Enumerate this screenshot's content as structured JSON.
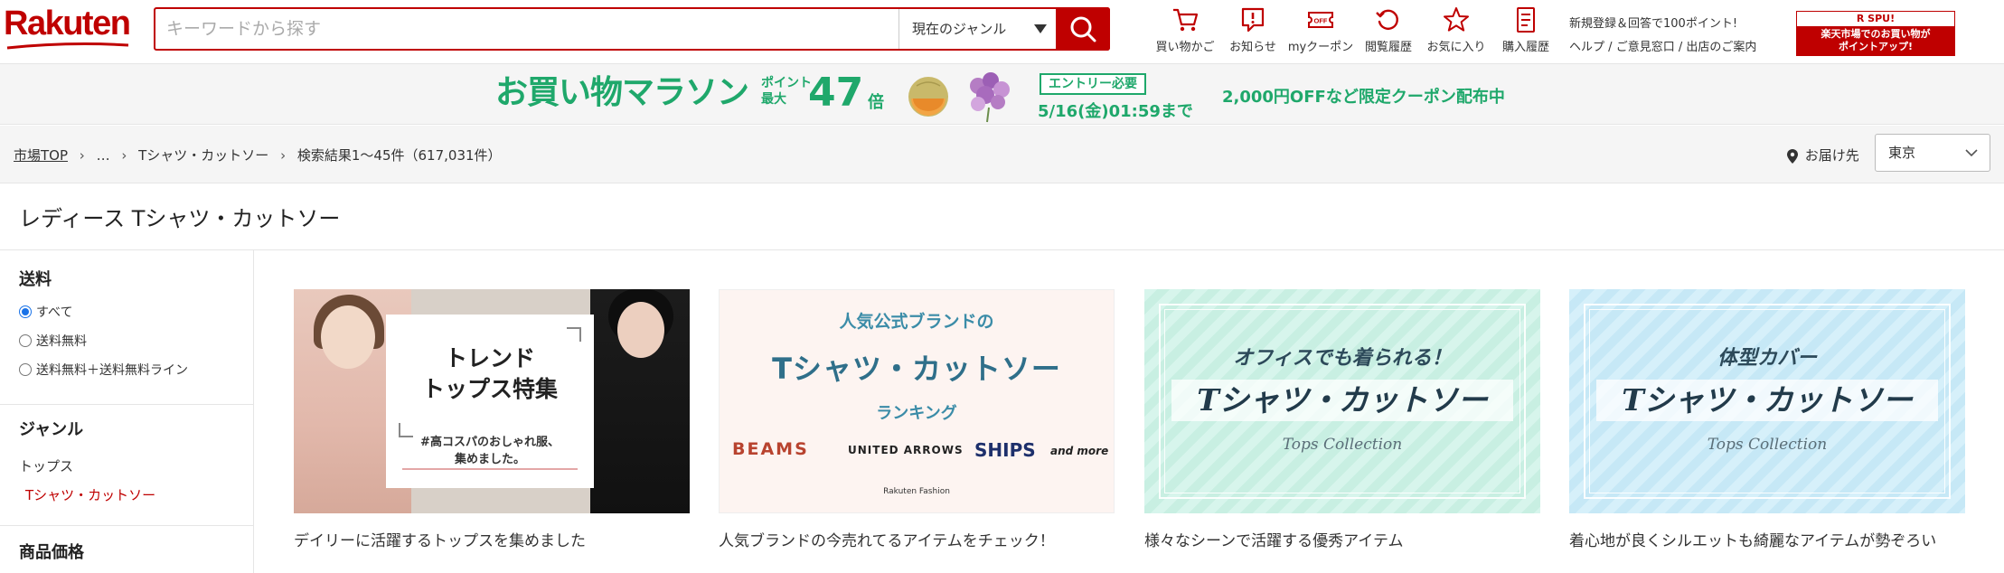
{
  "header": {
    "logo": "Rakuten",
    "search_placeholder": "キーワードから探す",
    "genre_select": "現在のジャンル",
    "nav": [
      {
        "label": "買い物かご",
        "icon": "cart-icon"
      },
      {
        "label": "お知らせ",
        "icon": "notice-icon"
      },
      {
        "label": "myクーポン",
        "icon": "coupon-icon"
      },
      {
        "label": "閲覧履歴",
        "icon": "history-icon"
      },
      {
        "label": "お気に入り",
        "icon": "star-icon"
      },
      {
        "label": "購入履歴",
        "icon": "receipt-icon"
      }
    ],
    "links": {
      "register": "新規登録＆回答で100ポイント!",
      "help": "ヘルプ",
      "feedback": "ご意見窓口",
      "seller": "出店のご案内",
      "slash": "/"
    },
    "spu": {
      "top": "R SPU!",
      "line1": "楽天市場でのお買い物が",
      "line2": "ポイントアップ!"
    }
  },
  "campaign": {
    "title": "お買い物マラソン",
    "point_label1": "ポイント",
    "point_label2": "最大",
    "point_num": "47",
    "point_unit": "倍",
    "entry": "エントリー必要",
    "date": "5/16(金)01:59まで",
    "coupon": "2,000円OFFなど限定クーポン配布中"
  },
  "breadcrumb": {
    "top": "市場TOP",
    "ellipsis": "…",
    "category": "Tシャツ・カットソー",
    "results": "検索結果1～45件（617,031件）"
  },
  "delivery": {
    "label": "お届け先",
    "region": "東京"
  },
  "page_title": "レディース Tシャツ・カットソー",
  "sidebar": {
    "shipping_heading": "送料",
    "shipping_options": [
      {
        "label": "すべて",
        "selected": true
      },
      {
        "label": "送料無料",
        "selected": false
      },
      {
        "label": "送料無料＋送料無料ライン",
        "selected": false
      }
    ],
    "genre_heading": "ジャンル",
    "genre_parent": "トップス",
    "genre_current": "Tシャツ・カットソー",
    "price_heading": "商品価格"
  },
  "cards": [
    {
      "caption": "デイリーに活躍するトップスを集めました",
      "line1": "トレンド",
      "line2": "トップス特集",
      "tag1": "#高コスパのおしゃれ服、",
      "tag2": "集めました。"
    },
    {
      "caption": "人気ブランドの今売れてるアイテムをチェック！",
      "line1": "人気公式ブランドの",
      "line2": "Tシャツ・カットソー",
      "line3": "ランキング",
      "brands": [
        "BEAMS",
        "UNITED ARROWS",
        "SHIPS",
        "and more"
      ],
      "footer": "Rakuten Fashion"
    },
    {
      "caption": "様々なシーンで活躍する優秀アイテム",
      "sub": "オフィスでも着られる！",
      "main": "Tシャツ・カットソー",
      "script": "Tops Collection"
    },
    {
      "caption": "着心地が良くシルエットも綺麗なアイテムが勢ぞろい",
      "sub": "体型カバー",
      "main": "Tシャツ・カットソー",
      "script": "Tops Collection"
    }
  ],
  "colors": {
    "brand_red": "#bf0000",
    "campaign_green": "#1fa86b",
    "link_red": "#bf0000"
  }
}
